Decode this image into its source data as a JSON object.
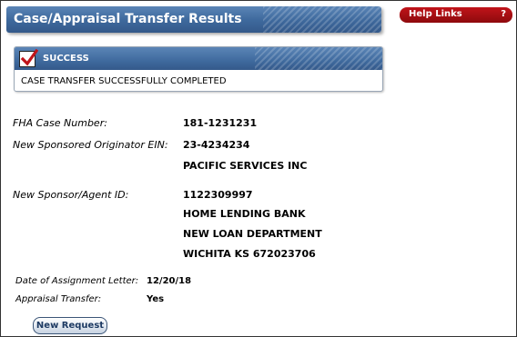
{
  "header": {
    "title": "Case/Appraisal Transfer Results",
    "help_links_label": "Help Links",
    "help_icon_glyph": "?"
  },
  "success": {
    "status": "SUCCESS",
    "message": "CASE TRANSFER SUCCESSFULLY COMPLETED",
    "icon": "checkmark-icon"
  },
  "details": {
    "fha_case_label": "FHA Case Number:",
    "fha_case_value": "181-1231231",
    "originator_ein_label": "New Sponsored Originator EIN:",
    "originator_ein_value": "23-4234234",
    "originator_name": "PACIFIC SERVICES INC",
    "sponsor_id_label": "New Sponsor/Agent ID:",
    "sponsor_id_value": "1122309997",
    "sponsor_name": "HOME LENDING BANK",
    "sponsor_dept": "NEW LOAN DEPARTMENT",
    "sponsor_city": "WICHITA KS 672023706",
    "assignment_date_label": "Date of Assignment Letter:",
    "assignment_date_value": "12/20/18",
    "appraisal_transfer_label": "Appraisal Transfer:",
    "appraisal_transfer_value": "Yes"
  },
  "actions": {
    "new_request_label": "New Request"
  },
  "colors": {
    "header_blue": "#3f6a9e",
    "help_red": "#b0111a"
  }
}
